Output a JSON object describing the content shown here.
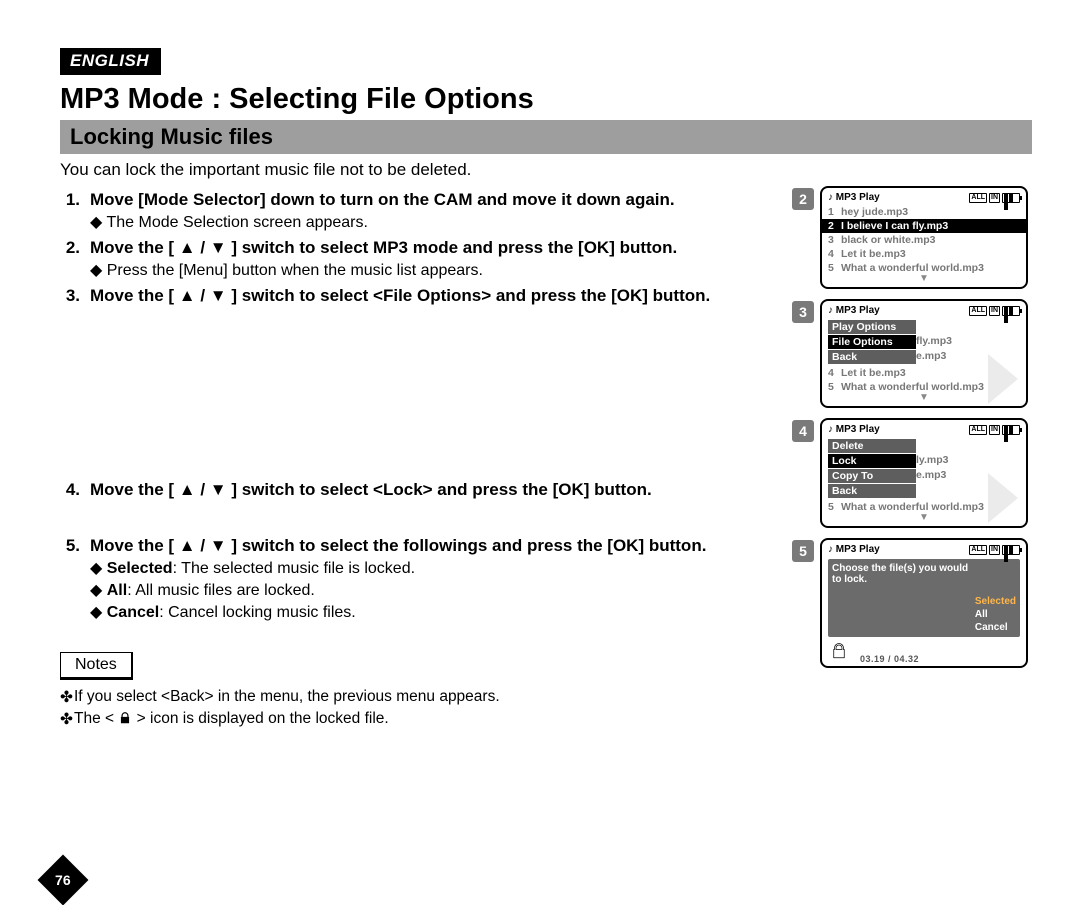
{
  "lang_tag": "ENGLISH",
  "title": "MP3 Mode : Selecting File Options",
  "subtitle": "Locking Music files",
  "intro": "You can lock the important music file not to be deleted.",
  "steps": {
    "s1": {
      "num": "1.",
      "lead": "Move [Mode Selector] down to turn on the CAM and move it down again.",
      "sub1": "The Mode Selection screen appears."
    },
    "s2": {
      "num": "2.",
      "lead_a": "Move the [ ",
      "lead_b": " ] switch to select MP3 mode and press the [OK] button.",
      "sub1": "Press the [Menu] button when the music list appears."
    },
    "s3": {
      "num": "3.",
      "lead_a": "Move the [ ",
      "lead_b": " ] switch to select <File Options> and press the [OK] button."
    },
    "s4": {
      "num": "4.",
      "lead_a": "Move the [ ",
      "lead_b": " ] switch to select <Lock> and press the [OK] button."
    },
    "s5": {
      "num": "5.",
      "lead_a": "Move the [ ",
      "lead_b": " ] switch to select the followings and press the [OK] button.",
      "opt1_b": "Selected",
      "opt1_t": ": The selected music file is locked.",
      "opt2_b": "All",
      "opt2_t": ": All music files are locked.",
      "opt3_b": "Cancel",
      "opt3_t": ": Cancel locking music files."
    }
  },
  "notes_label": "Notes",
  "notes": {
    "n1": "If you select <Back> in the menu, the previous menu appears.",
    "n2_a": "The < ",
    "n2_b": " > icon is displayed on the locked file."
  },
  "page_num": "76",
  "screens": {
    "title": "MP3 Play",
    "status_all": "ALL",
    "status_in": "IN",
    "list": {
      "r1": {
        "n": "1",
        "t": "hey jude.mp3"
      },
      "r2": {
        "n": "2",
        "t": "I believe I can fly.mp3"
      },
      "r3": {
        "n": "3",
        "t": "black or white.mp3"
      },
      "r4": {
        "n": "4",
        "t": "Let it be.mp3"
      },
      "r5": {
        "n": "5",
        "t": "What a wonderful world.mp3"
      }
    },
    "menu1": {
      "a": "Play Options",
      "b": "File Options",
      "c": "Back"
    },
    "peek1a": "fly.mp3",
    "peek1b": "e.mp3",
    "menu2": {
      "a": "Delete",
      "b": "Lock",
      "c": "Copy To",
      "d": "Back"
    },
    "peek2a": "ly.mp3",
    "peek2b": "e.mp3",
    "dialog": {
      "lead": "Choose the file(s) you would to lock.",
      "o1": "Selected",
      "o2": "All",
      "o3": "Cancel"
    },
    "timecode": "03.19 / 04.32",
    "badges": {
      "b2": "2",
      "b3": "3",
      "b4": "4",
      "b5": "5"
    }
  }
}
